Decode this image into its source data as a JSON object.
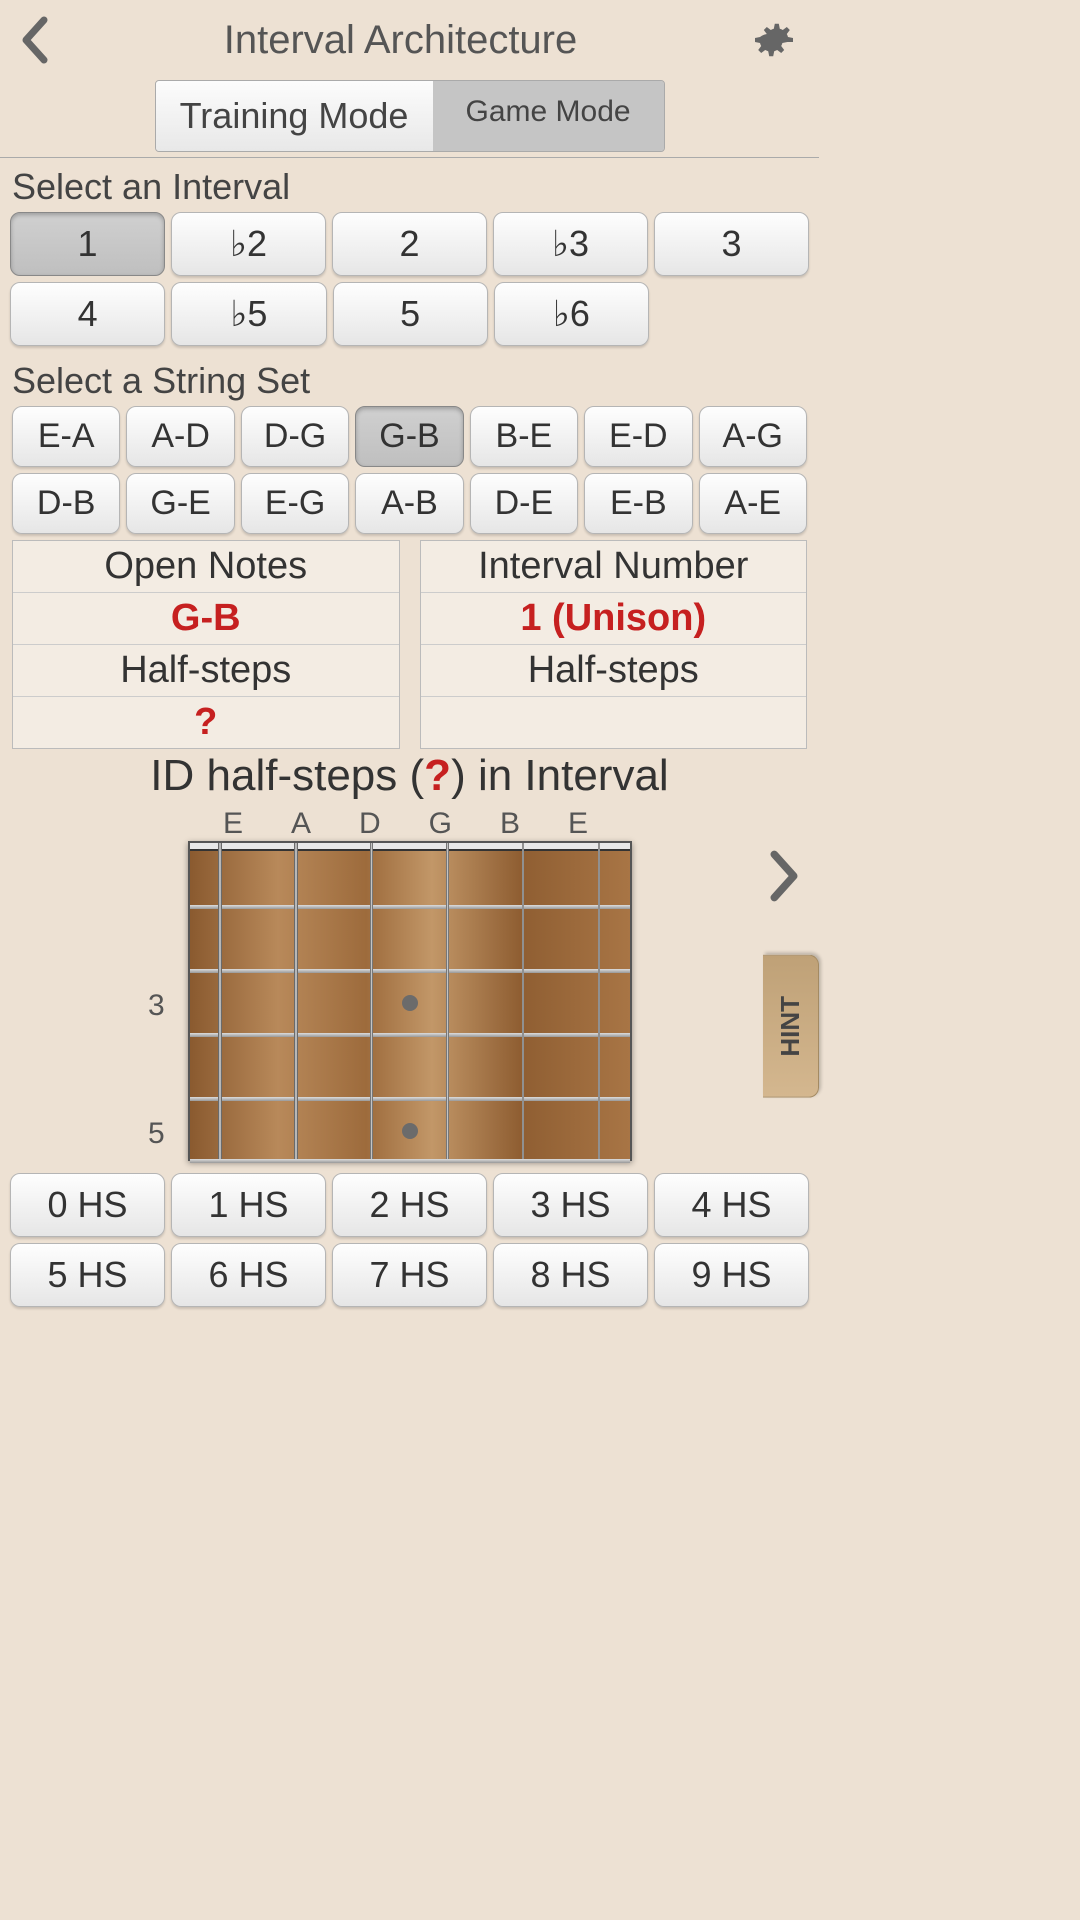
{
  "header": {
    "title": "Interval Architecture"
  },
  "modes": {
    "training": "Training Mode",
    "game": "Game Mode"
  },
  "interval_section": {
    "label": "Select an Interval",
    "row1": [
      "1",
      "♭2",
      "2",
      "♭3",
      "3"
    ],
    "row2": [
      "4",
      "♭5",
      "5",
      "♭6"
    ],
    "selected": "1"
  },
  "string_section": {
    "label": "Select a String Set",
    "row1": [
      "E-A",
      "A-D",
      "D-G",
      "G-B",
      "B-E",
      "E-D",
      "A-G"
    ],
    "row2": [
      "D-B",
      "G-E",
      "E-G",
      "A-B",
      "D-E",
      "E-B",
      "A-E"
    ],
    "selected": "G-B"
  },
  "info": {
    "open_notes_label": "Open Notes",
    "open_notes_value": "G-B",
    "halfsteps_label_left": "Half-steps",
    "halfsteps_value_left": "?",
    "interval_num_label": "Interval Number",
    "interval_num_value": "1 (Unison)",
    "halfsteps_label_right": "Half-steps",
    "halfsteps_value_right": ""
  },
  "prompt": {
    "pre": "ID half-steps (",
    "q": "?",
    "post": ") in Interval"
  },
  "fretboard": {
    "string_labels": [
      "E",
      "A",
      "D",
      "G",
      "B",
      "E"
    ],
    "fret_labels": {
      "3": "3",
      "5": "5"
    }
  },
  "hint_label": "HINT",
  "answers": {
    "row1": [
      "0 HS",
      "1 HS",
      "2 HS",
      "3 HS",
      "4 HS"
    ],
    "row2": [
      "5 HS",
      "6 HS",
      "7 HS",
      "8 HS",
      "9 HS"
    ]
  }
}
